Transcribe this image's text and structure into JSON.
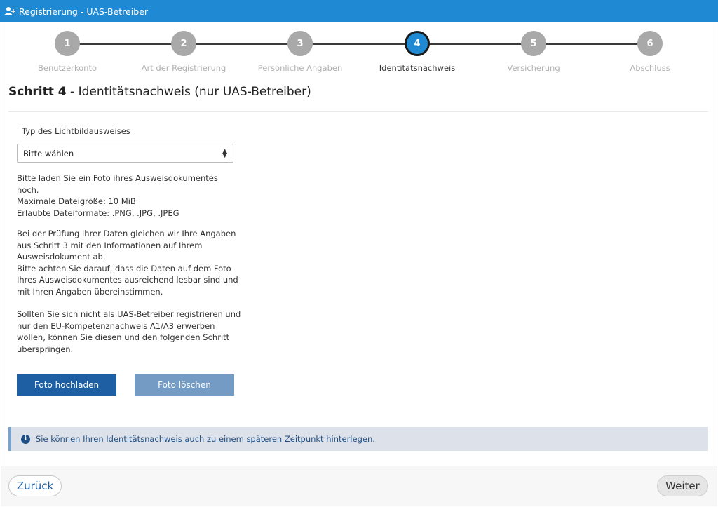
{
  "window": {
    "title": "Registrierung - UAS-Betreiber",
    "icon": "user-add-icon"
  },
  "stepper": {
    "steps": [
      {
        "number": "1",
        "label": "Benutzerkonto"
      },
      {
        "number": "2",
        "label": "Art der Registrierung"
      },
      {
        "number": "3",
        "label": "Persönliche Angaben"
      },
      {
        "number": "4",
        "label": "Identitätsnachweis"
      },
      {
        "number": "5",
        "label": "Versicherung"
      },
      {
        "number": "6",
        "label": "Abschluss"
      }
    ],
    "active_index": 3,
    "active_color": "#1f8ad3",
    "inactive_color": "#a9a9a9"
  },
  "page": {
    "step_prefix": "Schritt 4",
    "title_rest": " - Identitätsnachweis (nur UAS-Betreiber)"
  },
  "form": {
    "id_type_label": "Typ des Lichtbildausweises",
    "id_type_value": "Bitte wählen",
    "upload_intro": "Bitte laden Sie ein Foto ihres Ausweisdokumentes hoch.",
    "max_size": "Maximale Dateigröße: 10 MiB",
    "formats": "Erlaubte Dateiformate: .PNG, .JPG, .JPEG",
    "check_info_1": "Bei der Prüfung Ihrer Daten gleichen wir Ihre Angaben aus Schritt 3 mit den Informationen auf Ihrem Ausweisdokument ab.",
    "check_info_2": "Bitte achten Sie darauf, dass die Daten auf dem Foto Ihres Ausweisdokumentes ausreichend lesbar sind und mit Ihren Angaben übereinstimmen.",
    "skip_info": "Sollten Sie sich nicht als UAS-Betreiber registrieren und nur den EU-Kompetenznachweis A1/A3 erwerben wollen, können Sie diesen und den folgenden Schritt überspringen.",
    "upload_button": "Foto hochladen",
    "delete_button": "Foto löschen"
  },
  "info_banner": {
    "icon": "info-icon",
    "text": "Sie können Ihren Identitätsnachweis auch zu einem späteren Zeitpunkt hinterlegen."
  },
  "footer": {
    "back_label": "Zurück",
    "next_label": "Weiter"
  }
}
